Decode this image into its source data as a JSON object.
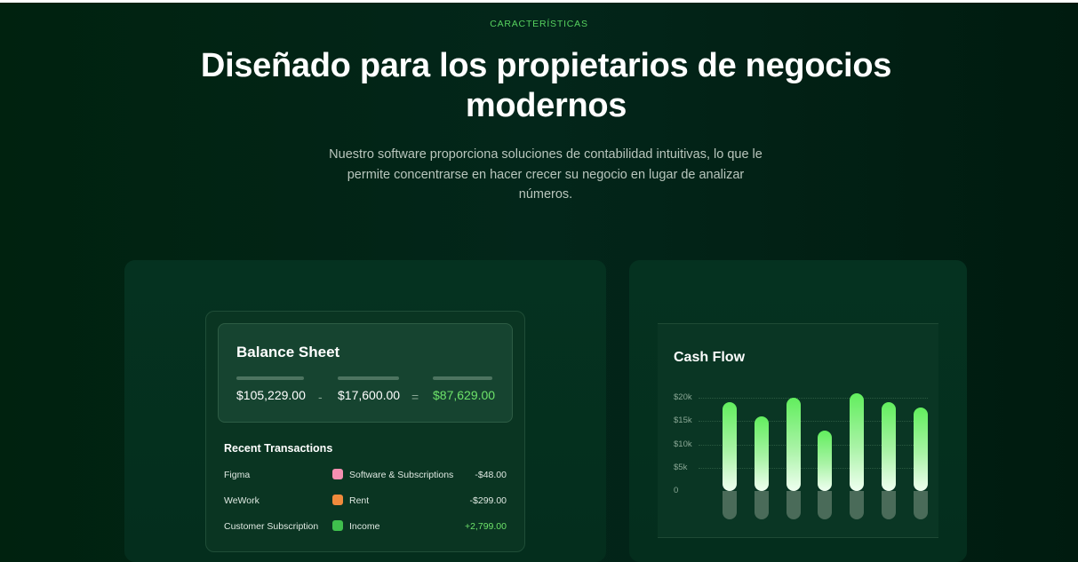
{
  "section": {
    "eyebrow": "CARACTERÍSTICAS",
    "title": "Diseñado para los propietarios de negocios modernos",
    "subtitle": "Nuestro software proporciona soluciones de contabilidad intuitivas, lo que le permite concentrarse en hacer crecer su negocio en lugar de analizar números."
  },
  "balance_sheet": {
    "title": "Balance Sheet",
    "assets": "$105,229.00",
    "minus": "-",
    "liabilities": "$17,600.00",
    "equals": "=",
    "equity": "$87,629.00",
    "equity_color": "#6ee36a"
  },
  "transactions": {
    "title": "Recent Transactions",
    "rows": [
      {
        "name": "Figma",
        "category": "Software & Subscriptions",
        "icon": "software-icon",
        "icon_color": "#f48fb1",
        "amount": "-$48.00"
      },
      {
        "name": "WeWork",
        "category": "Rent",
        "icon": "rent-icon",
        "icon_color": "#f08a3c",
        "amount": "-$299.00"
      },
      {
        "name": "Customer Subscription",
        "category": "Income",
        "icon": "income-icon",
        "icon_color": "#3fbf4d",
        "amount": "+2,799.00"
      }
    ]
  },
  "chart_data": {
    "type": "bar",
    "title": "Cash Flow",
    "y_ticks": [
      "$20k",
      "$15k",
      "$10k",
      "$5k",
      "0"
    ],
    "ylim": [
      0,
      20000
    ],
    "categories": [],
    "values": [
      19000,
      16000,
      20000,
      13000,
      21000,
      19000,
      18000
    ],
    "grid": true,
    "colors": {
      "bar_top": "#62ee5e",
      "bar_bottom": "#effff0",
      "base": "#4a6b59"
    }
  }
}
